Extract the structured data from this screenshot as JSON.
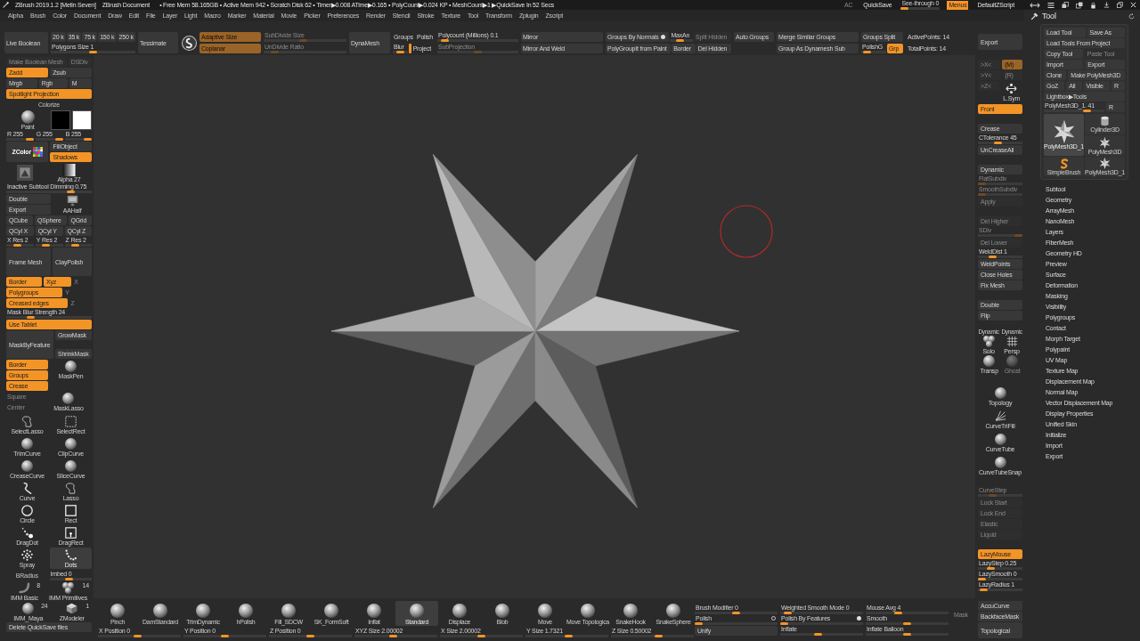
{
  "title_bar": {
    "title": "ZBrush 2019.1.2 [Metin Seven]",
    "document": "ZBrush Document",
    "stats": "• Free Mem 58.165GB • Active Mem 942 • Scratch Disk 62 • Timer▶0.008 ATime▶0.165 • PolyCount▶0.024 KP • MeshCount▶1 ▶QuickSave In 52 Secs",
    "controls": [
      {
        "kind": "button",
        "label": "AC",
        "on": false,
        "disabled": true
      },
      {
        "kind": "button",
        "label": "QuickSave",
        "on": false,
        "disabled": false
      },
      {
        "kind": "slider",
        "label": "See-through 0",
        "level": 0,
        "disabled": false
      },
      {
        "kind": "button",
        "label": "Menus",
        "on": true,
        "disabled": false
      },
      {
        "kind": "button",
        "label": "DefaultZScript",
        "on": false,
        "disabled": false
      }
    ]
  },
  "menu_bar": {
    "items": [
      "Alpha",
      "Brush",
      "Color",
      "Document",
      "Draw",
      "Edit",
      "File",
      "Layer",
      "Light",
      "Macro",
      "Marker",
      "Material",
      "Movie",
      "Picker",
      "Preferences",
      "Render",
      "Stencil",
      "Stroke",
      "Texture",
      "Tool",
      "Transform",
      "Zplugin",
      "Zscript"
    ]
  },
  "top_shelf": {
    "groups": [
      {
        "rows": [
          [
            {
              "kind": "big",
              "label": "Live Boolean",
              "on": false,
              "disabled": false
            }
          ]
        ]
      },
      {
        "rows": [
          [
            {
              "kind": "button",
              "label": "20 k",
              "on": false,
              "disabled": false
            },
            {
              "kind": "button",
              "label": "35 k",
              "on": false,
              "disabled": false
            },
            {
              "kind": "button",
              "label": "75 k",
              "on": false,
              "disabled": false
            },
            {
              "kind": "button",
              "label": "150 k",
              "on": false,
              "disabled": false
            },
            {
              "kind": "button",
              "label": "250 k",
              "on": false,
              "disabled": false
            }
          ],
          [
            {
              "kind": "slider",
              "label": "Polygons Size 1",
              "level": 0.5,
              "disabled": false
            }
          ]
        ]
      },
      {
        "rows": [
          [
            {
              "kind": "big",
              "label": "Tessimate",
              "on": false,
              "disabled": false
            }
          ]
        ]
      },
      {
        "rows": [
          [
            {
              "kind": "emblem"
            }
          ]
        ]
      },
      {
        "rows": [
          [
            {
              "kind": "button",
              "label": "Adaptive Size",
              "on": true,
              "disabled": true
            }
          ],
          [
            {
              "kind": "button",
              "label": "Coplanar",
              "on": true,
              "disabled": true
            }
          ]
        ]
      },
      {
        "rows": [
          [
            {
              "kind": "slider",
              "label": "SubDivide Size",
              "level": 0.48,
              "disabled": true
            }
          ],
          [
            {
              "kind": "slider",
              "label": "UnDivide Ratio",
              "level": 0.1,
              "disabled": true
            }
          ]
        ]
      },
      {
        "rows": [
          [
            {
              "kind": "big",
              "label": "DynaMesh",
              "on": false,
              "disabled": false
            }
          ]
        ]
      },
      {
        "rows": [
          [
            {
              "kind": "flat",
              "label": "Groups",
              "on": false,
              "disabled": false
            },
            {
              "kind": "flat",
              "label": "Polish",
              "on": false,
              "disabled": false
            }
          ],
          [
            {
              "kind": "slider",
              "label": "Blur",
              "level": 0.5,
              "disabled": false
            },
            {
              "kind": "switch",
              "on": true
            },
            {
              "kind": "flat",
              "label": "Project",
              "on": false,
              "disabled": false
            }
          ]
        ]
      },
      {
        "rows": [
          [
            {
              "kind": "slider",
              "label": "Polycount (Millions) 0.1",
              "level": 0.05,
              "disabled": false
            }
          ],
          [
            {
              "kind": "slider",
              "label": "SubProjection",
              "level": 0.5,
              "disabled": true
            }
          ]
        ]
      },
      {
        "rows": [
          [
            {
              "kind": "button",
              "label": "Mirror",
              "on": false,
              "disabled": false
            }
          ],
          [
            {
              "kind": "button",
              "label": "Mirror And Weld",
              "on": false,
              "disabled": false
            }
          ]
        ]
      },
      {
        "rows": [
          [
            {
              "kind": "button",
              "label": "Groups By Normals",
              "on": false,
              "disabled": false,
              "toggle": true
            },
            {
              "kind": "slider",
              "label": "MaxAn",
              "level": 0.4,
              "disabled": false
            },
            {
              "kind": "button",
              "label": "Split Hidden",
              "on": false,
              "disabled": true
            }
          ],
          [
            {
              "kind": "button",
              "label": "PolyGroupIt from Paint",
              "on": false,
              "disabled": false
            },
            {
              "kind": "button",
              "label": "Border",
              "on": false,
              "disabled": false
            },
            {
              "kind": "button",
              "label": "Del Hidden",
              "on": false,
              "disabled": false
            }
          ]
        ]
      },
      {
        "rows": [
          [
            {
              "kind": "button",
              "label": "Auto Groups",
              "on": false,
              "disabled": false
            }
          ]
        ]
      },
      {
        "rows": [
          [
            {
              "kind": "button",
              "label": "Merge Similar Groups",
              "on": false,
              "disabled": false
            }
          ],
          [
            {
              "kind": "button",
              "label": "Group As Dynamesh Sub",
              "on": false,
              "disabled": false
            }
          ]
        ]
      },
      {
        "rows": [
          [
            {
              "kind": "button",
              "label": "Groups Split",
              "on": false,
              "disabled": false
            }
          ],
          [
            {
              "kind": "slider",
              "label": "PolishG",
              "level": 0.1,
              "disabled": false
            },
            {
              "kind": "button",
              "label": "Grp",
              "on": true,
              "disabled": false
            }
          ]
        ]
      },
      {
        "rows": [
          [
            {
              "kind": "text",
              "label": "ActivePoints: 14"
            }
          ],
          [
            {
              "kind": "text",
              "label": "TotalPoints: 14"
            }
          ]
        ]
      }
    ]
  },
  "left_tray": {
    "rows_top": [
      [
        {
          "kind": "button",
          "label": "Make Boolean Mesh",
          "on": false,
          "disabled": true
        },
        {
          "kind": "button",
          "label": "DSDiv",
          "on": false,
          "disabled": true
        }
      ],
      [
        {
          "kind": "button",
          "label": "Zadd",
          "on": true,
          "disabled": false
        },
        {
          "kind": "button",
          "label": "Zsub",
          "on": false,
          "disabled": false
        }
      ],
      [
        {
          "kind": "button",
          "label": "Mrgb",
          "on": false,
          "disabled": false
        },
        {
          "kind": "button",
          "label": "Rgb",
          "on": false,
          "disabled": false
        },
        {
          "kind": "button",
          "label": "M",
          "on": false,
          "disabled": false
        }
      ],
      [
        {
          "kind": "button",
          "label": "Spotlight Projection",
          "on": true,
          "disabled": false
        }
      ],
      [
        {
          "kind": "label",
          "label": "Colorize"
        }
      ],
      [
        {
          "kind": "material",
          "label": "Paint"
        },
        {
          "kind": "swatch",
          "color": "#000000"
        },
        {
          "kind": "swatch",
          "color": "#ffffff"
        }
      ],
      [
        {
          "kind": "slider",
          "label": "R 255",
          "level": 1,
          "disabled": false
        },
        {
          "kind": "slider",
          "label": "G 255",
          "level": 1,
          "disabled": false
        },
        {
          "kind": "slider",
          "label": "B 255",
          "level": 1,
          "disabled": false
        }
      ],
      [
        {
          "kind": "zcolor",
          "label": "ZColor"
        },
        {
          "kind": "stack",
          "items": [
            {
              "kind": "button",
              "label": "FillObject",
              "on": false,
              "disabled": false
            },
            {
              "kind": "button",
              "label": "Shadows",
              "on": true,
              "disabled": false
            }
          ]
        }
      ],
      [
        {
          "kind": "texture"
        },
        {
          "kind": "alpha",
          "label": "Alpha 27"
        }
      ],
      [
        {
          "kind": "slider",
          "label": "Inactive Subtool Dimming 0.75",
          "level": 0.78,
          "disabled": false
        }
      ],
      [
        {
          "kind": "stack",
          "items": [
            {
              "kind": "button",
              "label": "Double",
              "on": false,
              "disabled": false
            },
            {
              "kind": "button",
              "label": "Export",
              "on": false,
              "disabled": false
            }
          ]
        },
        {
          "kind": "icon_button",
          "label": "AAHalf",
          "disabled": false
        }
      ],
      [
        {
          "kind": "button",
          "label": "QCube",
          "on": false,
          "disabled": false
        },
        {
          "kind": "button",
          "label": "QSphere",
          "on": false,
          "disabled": false
        },
        {
          "kind": "button",
          "label": "QGrid",
          "on": false,
          "disabled": false
        }
      ],
      [
        {
          "kind": "button",
          "label": "QCyl X",
          "on": false,
          "disabled": false
        },
        {
          "kind": "button",
          "label": "QCyl Y",
          "on": false,
          "disabled": false
        },
        {
          "kind": "button",
          "label": "QCyl Z",
          "on": false,
          "disabled": false
        }
      ],
      [
        {
          "kind": "slider",
          "label": "X Res 2",
          "level": 0.35,
          "disabled": false
        },
        {
          "kind": "slider",
          "label": "Y Res 2",
          "level": 0.35,
          "disabled": false
        },
        {
          "kind": "slider",
          "label": "Z Res 2",
          "level": 0.35,
          "disabled": false
        }
      ],
      [
        {
          "kind": "big",
          "label": "Frame Mesh",
          "on": false,
          "disabled": false
        },
        {
          "kind": "big",
          "label": "ClayPolish",
          "on": false,
          "disabled": false
        }
      ],
      [
        {
          "kind": "button",
          "label": "Border",
          "on": true,
          "disabled": false
        },
        {
          "kind": "button",
          "label": "Xyz",
          "on": true,
          "disabled": false
        },
        {
          "kind": "flat",
          "label": "X",
          "on": false,
          "disabled": true
        }
      ],
      [
        {
          "kind": "button",
          "label": "Polygroups",
          "on": true,
          "disabled": false
        },
        {
          "kind": "flat",
          "label": "Y",
          "on": false,
          "disabled": true
        }
      ],
      [
        {
          "kind": "button",
          "label": "Creased edges",
          "on": true,
          "disabled": false
        },
        {
          "kind": "flat",
          "label": "Z",
          "on": false,
          "disabled": true
        }
      ],
      [
        {
          "kind": "slider",
          "label": "Mask Blur Strength 24",
          "level": 0.26,
          "disabled": false
        }
      ],
      [
        {
          "kind": "button",
          "label": "Use Tablet",
          "on": true,
          "disabled": false
        }
      ],
      [
        {
          "kind": "big",
          "label": "MaskByFeature",
          "on": false,
          "disabled": false
        },
        {
          "kind": "stack",
          "items": [
            {
              "kind": "button",
              "label": "GrowMask",
              "on": false,
              "disabled": false
            },
            {
              "kind": "button",
              "label": "ShrinkMask",
              "on": false,
              "disabled": false
            }
          ]
        }
      ],
      [
        {
          "kind": "stack",
          "items": [
            {
              "kind": "button",
              "label": "Border",
              "on": true,
              "disabled": false
            },
            {
              "kind": "button",
              "label": "Groups",
              "on": true,
              "disabled": false
            },
            {
              "kind": "button",
              "label": "Crease",
              "on": true,
              "disabled": false
            }
          ]
        },
        {
          "kind": "tool",
          "label": "MaskPen",
          "selected": false
        }
      ],
      [
        {
          "kind": "stack",
          "items": [
            {
              "kind": "flat",
              "label": "Square",
              "on": false,
              "disabled": true
            },
            {
              "kind": "flat",
              "label": "Center",
              "on": false,
              "disabled": true
            }
          ]
        },
        {
          "kind": "tool",
          "label": "MaskLasso",
          "selected": false
        }
      ]
    ],
    "tools": [
      {
        "label": "SelectLasso",
        "selected": false
      },
      {
        "label": "SelectRect",
        "selected": false
      },
      {
        "label": "TrimCurve",
        "selected": false
      },
      {
        "label": "ClipCurve",
        "selected": false
      },
      {
        "label": "CreaseCurve",
        "selected": false
      },
      {
        "label": "SliceCurve",
        "selected": false
      },
      {
        "label": "Curve",
        "selected": false
      },
      {
        "label": "Lasso",
        "selected": false
      },
      {
        "label": "Circle",
        "selected": false
      },
      {
        "label": "Rect",
        "selected": false
      },
      {
        "label": "DragDot",
        "selected": false
      },
      {
        "label": "DragRect",
        "selected": false
      },
      {
        "label": "Spray",
        "selected": false
      },
      {
        "label": "Dots",
        "selected": true
      }
    ],
    "rows_bottom": [
      [
        {
          "kind": "label",
          "label": "BRadius"
        },
        {
          "kind": "slider",
          "label": "Imbed 0",
          "level": 0.45,
          "disabled": false
        }
      ],
      [
        {
          "kind": "tool",
          "label": "IMM Basic",
          "count": "8",
          "selected": false
        },
        {
          "kind": "tool",
          "label": "IMM Primitives",
          "count": "14",
          "selected": false
        }
      ],
      [
        {
          "kind": "tool",
          "label": "IMM_Maya",
          "count": "24",
          "selected": false
        },
        {
          "kind": "tool",
          "label": "ZModeler",
          "count": "1",
          "selected": false
        }
      ],
      [
        {
          "kind": "button",
          "label": "Delete QuickSave files",
          "on": false,
          "disabled": false
        }
      ]
    ]
  },
  "right_shelf": {
    "groups": [
      [
        [
          {
            "kind": "big",
            "label": "Export",
            "on": false,
            "disabled": false
          }
        ]
      ],
      [
        [
          {
            "kind": "button",
            "label": ">X<",
            "on": false,
            "disabled": true
          },
          {
            "kind": "button",
            "label": "(M)",
            "on": true,
            "disabled": true
          }
        ],
        [
          {
            "kind": "button",
            "label": ">Y<",
            "on": false,
            "disabled": true
          },
          {
            "kind": "button",
            "label": "(R)",
            "on": false,
            "disabled": true
          }
        ],
        [
          {
            "kind": "button",
            "label": ">Z<",
            "on": false,
            "disabled": true
          },
          {
            "kind": "icon_button",
            "label": "L.Sym",
            "disabled": false
          }
        ],
        [
          {
            "kind": "button",
            "label": "Front",
            "on": true,
            "disabled": false
          }
        ]
      ],
      [
        [
          {
            "kind": "button",
            "label": "Crease",
            "on": false,
            "disabled": false
          }
        ],
        [
          {
            "kind": "slider",
            "label": "CTolerance 45",
            "level": 0.45,
            "disabled": false
          }
        ],
        [
          {
            "kind": "button",
            "label": "UnCreaseAll",
            "on": false,
            "disabled": false
          }
        ]
      ],
      [
        [
          {
            "kind": "button",
            "label": "Dynamic",
            "on": false,
            "disabled": false
          }
        ],
        [
          {
            "kind": "slider",
            "label": "FlatSubdiv",
            "level": 0,
            "disabled": true
          }
        ],
        [
          {
            "kind": "slider",
            "label": "SmoothSubdiv",
            "level": 0,
            "disabled": true
          }
        ],
        [
          {
            "kind": "button",
            "label": "Apply",
            "on": false,
            "disabled": true
          }
        ]
      ],
      [
        [
          {
            "kind": "button",
            "label": "Del Higher",
            "on": false,
            "disabled": true
          }
        ],
        [
          {
            "kind": "slider",
            "label": "SDiv",
            "level": 1,
            "disabled": true
          }
        ],
        [
          {
            "kind": "button",
            "label": "Del Lower",
            "on": false,
            "disabled": true
          }
        ],
        [
          {
            "kind": "slider",
            "label": "WeldDist 1",
            "level": 0.3,
            "disabled": false
          }
        ],
        [
          {
            "kind": "button",
            "label": "WeldPoints",
            "on": false,
            "disabled": false
          }
        ],
        [
          {
            "kind": "button",
            "label": "Close Holes",
            "on": false,
            "disabled": false
          }
        ],
        [
          {
            "kind": "button",
            "label": "Fix Mesh",
            "on": false,
            "disabled": false
          }
        ]
      ],
      [
        [
          {
            "kind": "button",
            "label": "Double",
            "on": false,
            "disabled": false
          }
        ],
        [
          {
            "kind": "button",
            "label": "Flip",
            "on": false,
            "disabled": false
          }
        ]
      ],
      [
        [
          {
            "kind": "icon_button",
            "label": "Solo",
            "note": "Dynamic",
            "disabled": false
          },
          {
            "kind": "icon_button",
            "label": "Persp",
            "note": "Dynamic",
            "disabled": false
          }
        ],
        [
          {
            "kind": "icon_button",
            "label": "Transp",
            "disabled": false
          },
          {
            "kind": "icon_button",
            "label": "Ghost",
            "disabled": true
          }
        ]
      ],
      [
        [
          {
            "kind": "icon_button",
            "label": "Topology",
            "disabled": false
          }
        ],
        [
          {
            "kind": "icon_button",
            "label": "CurveTriFill",
            "disabled": false
          }
        ],
        [
          {
            "kind": "icon_button",
            "label": "CurveTube",
            "disabled": false
          }
        ],
        [
          {
            "kind": "icon_button",
            "label": "CurveTubeSnap",
            "disabled": false
          }
        ]
      ],
      [
        [
          {
            "kind": "slider",
            "label": "CurveStep",
            "level": 0.3,
            "disabled": true
          }
        ],
        [
          {
            "kind": "button",
            "label": "Lock Start",
            "on": false,
            "disabled": true
          }
        ],
        [
          {
            "kind": "button",
            "label": "Lock End",
            "on": false,
            "disabled": true
          }
        ],
        [
          {
            "kind": "button",
            "label": "Elastic",
            "on": false,
            "disabled": true
          }
        ],
        [
          {
            "kind": "button",
            "label": "Liquid",
            "on": false,
            "disabled": true
          }
        ]
      ],
      [
        [
          {
            "kind": "button",
            "label": "LazyMouse",
            "on": true,
            "disabled": false
          }
        ],
        [
          {
            "kind": "slider",
            "label": "LazyStep 0.25",
            "level": 0.25,
            "disabled": false
          }
        ],
        [
          {
            "kind": "slider",
            "label": "LazySmooth 0",
            "level": 0,
            "disabled": false
          }
        ],
        [
          {
            "kind": "slider",
            "label": "LazyRadius 1",
            "level": 0.05,
            "disabled": false
          }
        ]
      ],
      [
        [
          {
            "kind": "button",
            "label": "AccuCurve",
            "on": false,
            "disabled": false
          }
        ],
        [
          {
            "kind": "button",
            "label": "BackfaceMask",
            "on": false,
            "disabled": false
          }
        ],
        [
          {
            "kind": "big",
            "label": "Topological",
            "on": false,
            "disabled": false
          }
        ]
      ]
    ]
  },
  "tool_palette": {
    "title": "Tool",
    "rows": [
      [
        {
          "kind": "button",
          "label": "Load Tool",
          "on": false,
          "disabled": false
        },
        {
          "kind": "button",
          "label": "Save As",
          "on": false,
          "disabled": false
        }
      ],
      [
        {
          "kind": "button",
          "label": "Load Tools From Project",
          "on": false,
          "disabled": false
        }
      ],
      [
        {
          "kind": "button",
          "label": "Copy Tool",
          "on": false,
          "disabled": false
        },
        {
          "kind": "button",
          "label": "Paste Tool",
          "on": false,
          "disabled": true
        }
      ],
      [
        {
          "kind": "button",
          "label": "Import",
          "on": false,
          "disabled": false
        },
        {
          "kind": "button",
          "label": "Export",
          "on": false,
          "disabled": false
        }
      ],
      [
        {
          "kind": "button",
          "label": "Clone",
          "on": false,
          "disabled": false
        },
        {
          "kind": "button",
          "label": "Make PolyMesh3D",
          "on": false,
          "disabled": false
        }
      ],
      [
        {
          "kind": "button",
          "label": "GoZ",
          "on": false,
          "disabled": false
        },
        {
          "kind": "button",
          "label": "All",
          "on": false,
          "disabled": false
        },
        {
          "kind": "button",
          "label": "Visible",
          "on": false,
          "disabled": false
        },
        {
          "kind": "button",
          "label": "R",
          "on": false,
          "disabled": false
        }
      ],
      [
        {
          "kind": "button",
          "label": "Lightbox▶Tools",
          "on": false,
          "disabled": false
        }
      ],
      [
        {
          "kind": "slider",
          "label": "PolyMesh3D_1. 41",
          "level": 0.75,
          "disabled": false
        },
        {
          "kind": "button",
          "label": "R",
          "on": false,
          "disabled": false
        }
      ]
    ],
    "thumbnails": [
      {
        "label": "PolyMesh3D_1",
        "selected": true
      },
      {
        "label": "SimpleBrush",
        "selected": false
      },
      {
        "label": "Cylinder3D",
        "selected": false
      },
      {
        "label": "PolyMesh3D",
        "selected": false
      },
      {
        "label": "PolyMesh3D_1",
        "selected": false
      }
    ],
    "subpalettes": [
      "Subtool",
      "Geometry",
      "ArrayMesh",
      "NanoMesh",
      "Layers",
      "FiberMesh",
      "Geometry HD",
      "Preview",
      "Surface",
      "Deformation",
      "Masking",
      "Visibility",
      "Polygroups",
      "Contact",
      "Morph Target",
      "Polypaint",
      "UV Map",
      "Texture Map",
      "Displacement Map",
      "Normal Map",
      "Vector Displacement Map",
      "Display Properties",
      "Unified Skin",
      "Initialize",
      "Import",
      "Export"
    ]
  },
  "bottom_shelf": {
    "brushes": [
      {
        "label": "Pinch",
        "selected": false
      },
      {
        "label": "DamStandard",
        "selected": false
      },
      {
        "label": "TrimDynamic",
        "selected": false
      },
      {
        "label": "hPolish",
        "selected": false
      },
      {
        "label": "Fill_SDCW",
        "selected": false
      },
      {
        "label": "SK_FormSoft",
        "selected": false
      },
      {
        "label": "Inflat",
        "selected": false
      },
      {
        "label": "Standard",
        "selected": true
      },
      {
        "label": "Displace",
        "selected": false
      },
      {
        "label": "Blob",
        "selected": false
      },
      {
        "label": "Move",
        "selected": false
      },
      {
        "label": "Move Topologica",
        "selected": false
      },
      {
        "label": "SnakeHook",
        "selected": false
      },
      {
        "label": "SnakeSphere",
        "selected": false
      }
    ],
    "sliders": [
      {
        "kind": "slider",
        "label": "X Position 0",
        "level": 0.48,
        "disabled": false
      },
      {
        "kind": "slider",
        "label": "Y Position 0",
        "level": 0.5,
        "disabled": false
      },
      {
        "kind": "slider",
        "label": "Z Position 0",
        "level": 0.5,
        "disabled": false
      },
      {
        "kind": "slider",
        "label": "XYZ Size 2.00002",
        "level": 0.47,
        "disabled": false
      },
      {
        "kind": "slider",
        "label": "X Size 2.00002",
        "level": 0.5,
        "disabled": false
      },
      {
        "kind": "slider",
        "label": "Y Size 1.7321",
        "level": 0.52,
        "disabled": false
      },
      {
        "kind": "slider",
        "label": "Z Size 0.50002",
        "level": 0.58,
        "disabled": false
      }
    ],
    "settings": [
      [
        {
          "kind": "slider",
          "label": "Brush Modifier 0",
          "level": 0.5,
          "disabled": false
        },
        {
          "kind": "slider",
          "label": "Polish",
          "level": 0,
          "disabled": false,
          "toggle": false
        },
        {
          "kind": "button",
          "label": "Unify",
          "on": false,
          "disabled": false
        }
      ],
      [
        {
          "kind": "slider",
          "label": "Weighted Smooth Mode 0",
          "level": 0.05,
          "disabled": false
        },
        {
          "kind": "slider",
          "label": "Polish By Features",
          "level": 0,
          "disabled": false,
          "toggle": true
        },
        {
          "kind": "slider",
          "label": "Inflate",
          "level": 0.45,
          "disabled": false
        }
      ],
      [
        {
          "kind": "slider",
          "label": "Mouse Avg 4",
          "level": 0.38,
          "disabled": false
        },
        {
          "kind": "slider",
          "label": "Smooth",
          "level": 0.5,
          "disabled": false
        },
        {
          "kind": "slider",
          "label": "Inflate Balloon",
          "level": 0.5,
          "disabled": false
        }
      ]
    ],
    "mask_toggle": {
      "kind": "flat",
      "label": "Mask",
      "on": false,
      "disabled": true
    }
  }
}
